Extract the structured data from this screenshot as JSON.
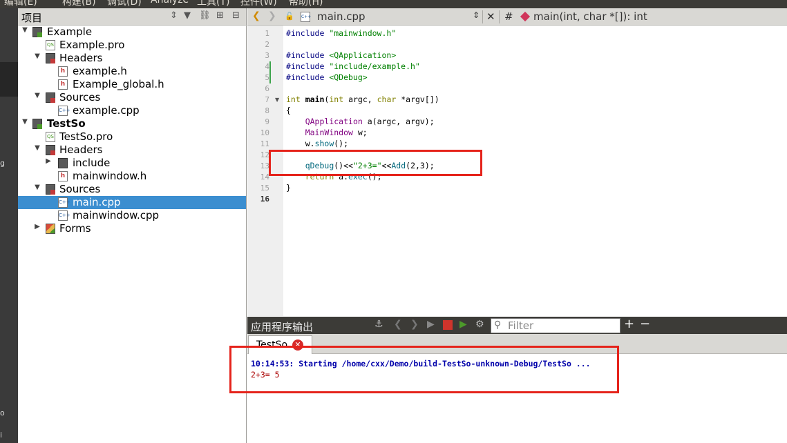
{
  "menubar": {
    "items": [
      "编辑(E)",
      "构建(B)",
      "调试(D)",
      "Analyze",
      "工具(T)",
      "控件(W)",
      "帮助(H)"
    ]
  },
  "modebar": {
    "fragments": [
      "g",
      "o",
      "i"
    ]
  },
  "project_pane": {
    "title": "项目",
    "tree": [
      {
        "label": "Example",
        "depth": 0,
        "expanded": true,
        "icon": "project-qt-icon"
      },
      {
        "label": "Example.pro",
        "depth": 1,
        "icon": "pro-file-icon"
      },
      {
        "label": "Headers",
        "depth": 1,
        "expanded": true,
        "icon": "headers-folder-icon"
      },
      {
        "label": "example.h",
        "depth": 2,
        "icon": "header-file-icon"
      },
      {
        "label": "Example_global.h",
        "depth": 2,
        "icon": "header-file-icon"
      },
      {
        "label": "Sources",
        "depth": 1,
        "expanded": true,
        "icon": "sources-folder-icon"
      },
      {
        "label": "example.cpp",
        "depth": 2,
        "icon": "cpp-file-icon"
      },
      {
        "label": "TestSo",
        "depth": 0,
        "expanded": true,
        "bold": true,
        "icon": "project-qt-icon"
      },
      {
        "label": "TestSo.pro",
        "depth": 1,
        "icon": "pro-file-icon"
      },
      {
        "label": "Headers",
        "depth": 1,
        "expanded": true,
        "icon": "headers-folder-icon"
      },
      {
        "label": "include",
        "depth": 2,
        "expanded": false,
        "icon": "folder-icon"
      },
      {
        "label": "mainwindow.h",
        "depth": 2,
        "icon": "header-file-icon"
      },
      {
        "label": "Sources",
        "depth": 1,
        "expanded": true,
        "icon": "sources-folder-icon"
      },
      {
        "label": "main.cpp",
        "depth": 2,
        "selected": true,
        "icon": "cpp-file-icon"
      },
      {
        "label": "mainwindow.cpp",
        "depth": 2,
        "icon": "cpp-file-icon"
      },
      {
        "label": "Forms",
        "depth": 1,
        "expanded": false,
        "icon": "forms-folder-icon"
      }
    ]
  },
  "editor": {
    "file_name": "main.cpp",
    "hash": "#",
    "symbol": "main(int, char *[]): int",
    "current_line": 16,
    "lines": [
      "#include \"mainwindow.h\"",
      "",
      "#include <QApplication>",
      "#include \"include/example.h\"",
      "#include <QDebug>",
      "",
      "int main(int argc, char *argv[])",
      "{",
      "    QApplication a(argc, argv);",
      "    MainWindow w;",
      "    w.show();",
      "",
      "    qDebug()<<\"2+3=\"<<Add(2,3);",
      "    return a.exec();",
      "}",
      ""
    ]
  },
  "output": {
    "title": "应用程序输出",
    "filter_placeholder": "Filter",
    "tab_label": "TestSo",
    "lines": [
      {
        "text": "10:14:53: Starting /home/cxx/Demo/build-TestSo-unknown-Debug/TestSo ...",
        "style": "info"
      },
      {
        "text": "2+3= 5",
        "style": "stdout"
      }
    ]
  },
  "colors": {
    "highlight_box": "#e5231b",
    "selection": "#3b8ed0",
    "change_marker": "#3aa34a"
  }
}
